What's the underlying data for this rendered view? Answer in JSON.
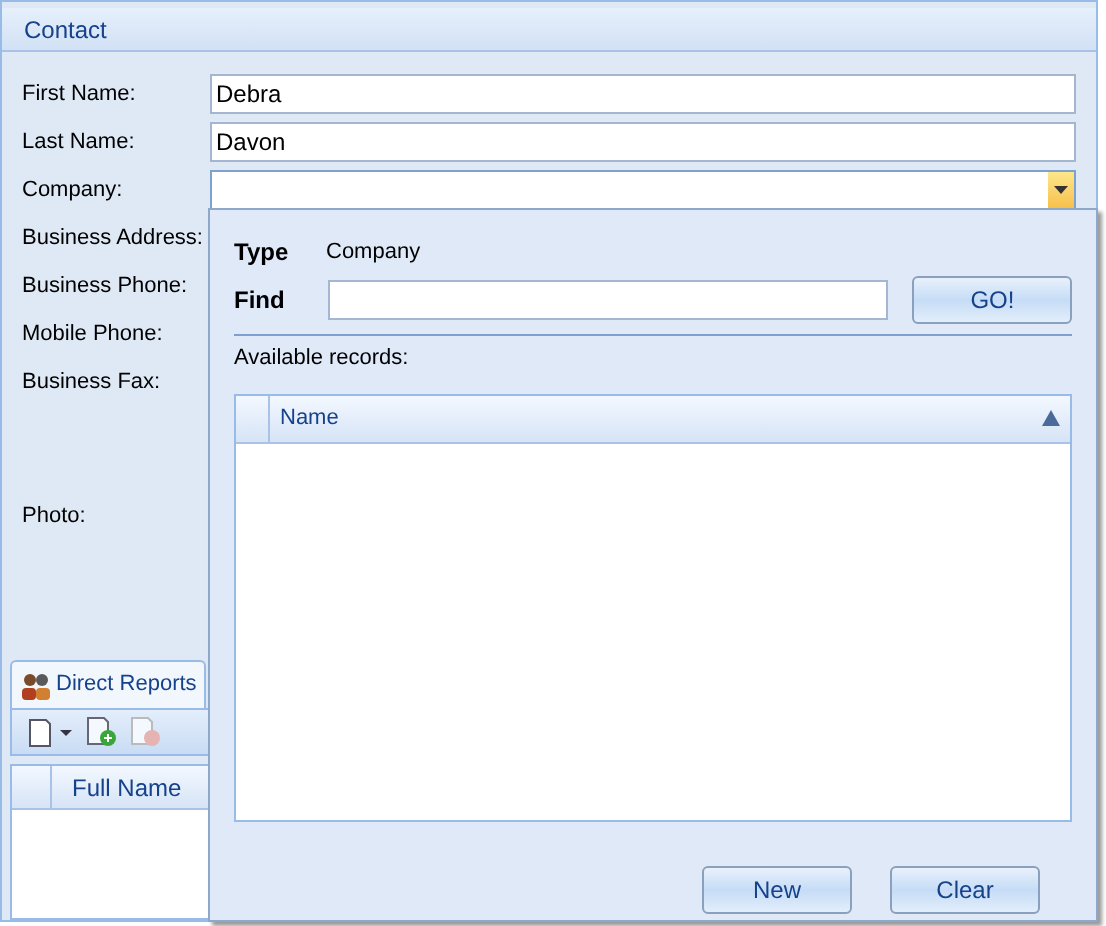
{
  "section": {
    "title": "Contact"
  },
  "fields": [
    {
      "label": "First Name:",
      "kind": "text",
      "value": "Debra"
    },
    {
      "label": "Last Name:",
      "kind": "text",
      "value": "Davon"
    },
    {
      "label": "Company:",
      "kind": "combo"
    },
    {
      "label": "Business Address:",
      "kind": "label"
    },
    {
      "label": "Business Phone:",
      "kind": "label"
    },
    {
      "label": "Mobile Phone:",
      "kind": "label"
    },
    {
      "label": "Business Fax:",
      "kind": "label"
    },
    {
      "label": "Photo:",
      "kind": "photo"
    }
  ],
  "tabs": [
    {
      "label": "Direct Reports",
      "selected": true
    }
  ],
  "grid": {
    "columns": [
      "Full Name"
    ]
  },
  "popup": {
    "type_label": "Type",
    "type_value": "Company",
    "find_label": "Find",
    "find_button": "GO!",
    "records_label": "Available records:",
    "columns": [
      {
        "label": "Name",
        "sorted": true
      }
    ],
    "buttons": [
      "New",
      "Clear"
    ]
  }
}
